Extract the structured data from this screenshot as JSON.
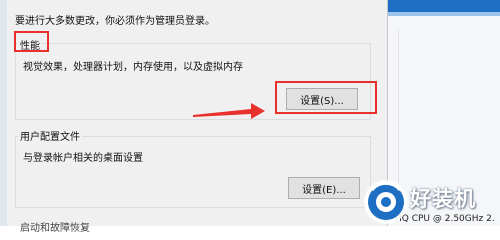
{
  "dialog": {
    "notice": "要进行大多数更改，你必须作为管理员登录。",
    "performance": {
      "title": "性能",
      "description": "视觉效果，处理器计划，内存使用，以及虚拟内存",
      "button": "设置(S)..."
    },
    "user_profiles": {
      "title": "用户配置文件",
      "description": "与登录帐户相关的桌面设置",
      "button": "设置(E)..."
    },
    "startup_recovery_clipped": "启动和故障恢复"
  },
  "background_window": {
    "cpu_text": "HQ CPU @ 2.50GHz 2."
  },
  "watermark": {
    "text": "好装机"
  },
  "colors": {
    "highlight": "#e8302c",
    "accent": "#1e6fc4"
  }
}
